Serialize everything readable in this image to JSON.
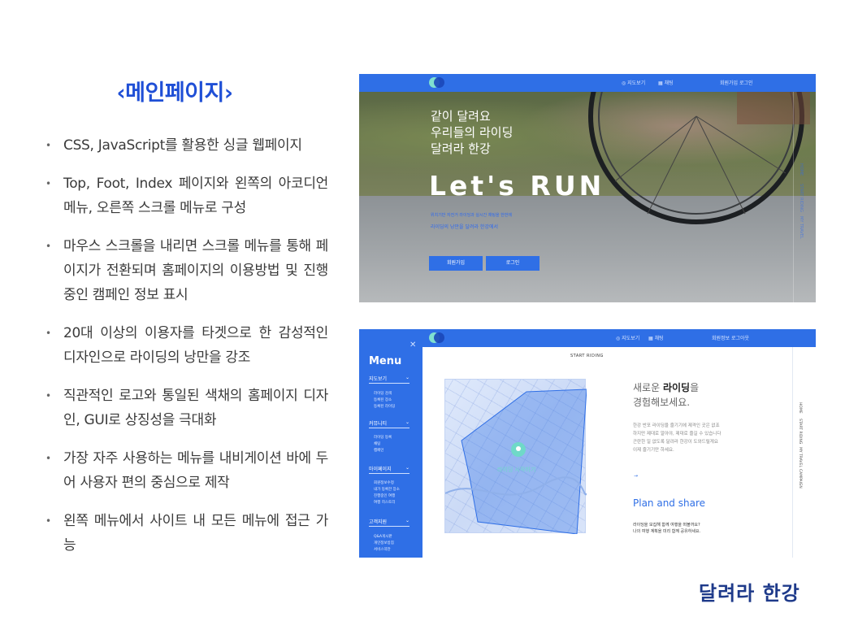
{
  "slide": {
    "title": "‹메인페이지›",
    "bullet_symbol": "•",
    "bullets": [
      "CSS, JavaScript를 활용한 싱글 웹페이지",
      "Top, Foot, Index 페이지와 왼쪽의 아코디언 메뉴, 오른쪽 스크롤 메뉴로 구성",
      "마우스 스크롤을 내리면 스크롤 메뉴를 통해 페이지가 전환되며 홈페이지의 이용방법 및 진행중인 캠페인 정보 표시",
      "20대 이상의 이용자를 타겟으로 한 감성적인 디자인으로 라이딩의 낭만을 강조",
      "직관적인 로고와 통일된 색채의 홈페이지 디자인, GUI로 상징성을 극대화",
      "가장 자주 사용하는 메뉴를 내비게이션 바에 두어 사용자 편의 중심으로 제작",
      "왼쪽 메뉴에서 사이트 내 모든 메뉴에 접근 가능"
    ],
    "brand": "달려라 한강"
  },
  "shot1": {
    "nav": [
      "◎ 지도보기",
      "▦ 채팅",
      "회원가입  로그인"
    ],
    "hero_sub": [
      "같이 달려요",
      "우리들의 라이딩",
      "달려라 한강"
    ],
    "hero_title": "Let's RUN",
    "desc1": "위치기반 자전거 라이딩과 실시간 채팅을 한번에",
    "desc2": "라이딩의 낭만을 달려라 한강에서",
    "buttons": [
      "회원가입",
      "로그인"
    ],
    "vertical_nav": [
      "HOME",
      "START RIDING",
      "MY TRAVEL",
      "CAMPAIGN"
    ]
  },
  "shot2": {
    "nav": [
      "◎ 지도보기",
      "▦ 채팅",
      "회원정보  로그아웃"
    ],
    "close": "✕",
    "menu_title": "Menu",
    "sections": [
      {
        "label": "지도보기",
        "chev": "⌄",
        "items": [
          "라이딩 검색",
          "등록된 장소",
          "등록된 라이딩"
        ]
      },
      {
        "label": "커뮤니티",
        "chev": "⌄",
        "items": [
          "라이딩 등록",
          "채팅",
          "캠페인"
        ]
      },
      {
        "label": "마이페이지",
        "chev": "⌄",
        "items": [
          "회원정보수정",
          "내가 등록한 장소",
          "진행중인 여행",
          "여행 히스토리"
        ]
      },
      {
        "label": "고객지원",
        "chev": "⌄",
        "items": [
          "Q&A게시판",
          "개인정보방침",
          "서비스약관"
        ]
      }
    ],
    "start_riding": "START RIDING",
    "map_label": "라이딩 시작하기",
    "new_ride_pre": "새로운 ",
    "new_ride_bold": "라이딩",
    "new_ride_post": "을",
    "new_ride_line2": "경험해보세요.",
    "ride_desc": [
      "한강 반포 라이딩을 즐기기에 제격인 곳은 없죠",
      "하지만 제대로 알아야, 제대로 즐길 수 있습니다",
      "곤란한 일 없도록 달려라 한강이 도와드릴게요",
      "이제 즐기기만 하세요."
    ],
    "arrow": "→",
    "plan_title": "Plan and share",
    "plan_desc1": "라이딩을 모집해 함께 여행을 떠볼까요?",
    "plan_desc2": "나의 여행 계획을 미리 함께 공유하세요.",
    "vertical_nav": [
      "HOME",
      "START RIDING",
      "MY TRAVEL",
      "CAMPAIGN"
    ]
  },
  "colors": {
    "accent_blue": "#2f6fe6",
    "title_blue": "#1f4fd6",
    "brand_navy": "#1e3a8a",
    "logo_mint": "#7fe0d0"
  }
}
